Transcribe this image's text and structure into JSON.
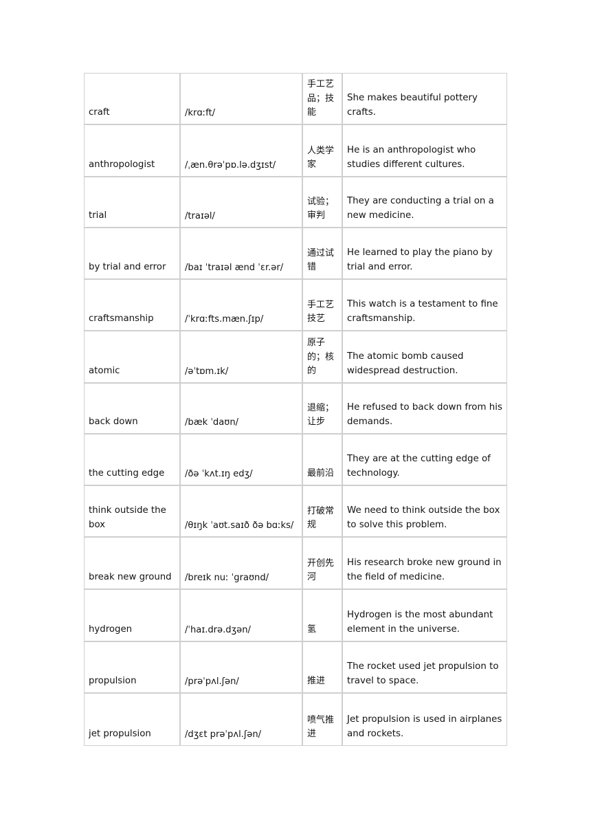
{
  "document": {
    "type": "vocabulary-table",
    "background_color": "#ffffff",
    "text_color": "#121212",
    "border_color": "#cfcfcf",
    "columns": [
      "word",
      "phonetic",
      "meaning_zh",
      "example"
    ]
  },
  "table": {
    "rows": [
      {
        "word": "craft",
        "phonetic": "/krɑːft/",
        "meaning_zh": "手工艺品；技能",
        "example": "She makes beautiful pottery crafts."
      },
      {
        "word": "anthropologist",
        "phonetic": "/ˌæn.θrəˈpɒ.lə.dʒɪst/",
        "meaning_zh": "人类学家",
        "example": "He is an anthropologist who studies different cultures."
      },
      {
        "word": "trial",
        "phonetic": "/traɪəl/",
        "meaning_zh": "试验；审判",
        "example": "They are conducting a trial on a new medicine."
      },
      {
        "word": "by trial and error",
        "phonetic": "/baɪ ˈtraɪəl ænd ˈɛr.ər/",
        "meaning_zh": "通过试错",
        "example": "He learned to play the piano by trial and error."
      },
      {
        "word": "craftsmanship",
        "phonetic": "/ˈkrɑːfts.mæn.ʃɪp/",
        "meaning_zh": "手工艺技艺",
        "example": "This watch is a testament to fine craftsmanship."
      },
      {
        "word": "atomic",
        "phonetic": "/əˈtɒm.ɪk/",
        "meaning_zh": "原子的；核的",
        "example": "The atomic bomb caused widespread destruction."
      },
      {
        "word": "back down",
        "phonetic": "/bæk ˈdaʊn/",
        "meaning_zh": "退缩；让步",
        "example": "He refused to back down from his demands."
      },
      {
        "word": "the cutting edge",
        "phonetic": "/ðə ˈkʌt.ɪŋ edʒ/",
        "meaning_zh": "最前沿",
        "example": "They are at the cutting edge of technology."
      },
      {
        "word": "think outside the box",
        "phonetic": "/θɪŋk ˈaʊt.saɪð ðə bɑːks/",
        "meaning_zh": "打破常规",
        "example": "We need to think outside the box to solve this problem."
      },
      {
        "word": "break new ground",
        "phonetic": "/breɪk nuː ˈgraʊnd/",
        "meaning_zh": "开创先河",
        "example": "His research broke new ground in the field of medicine."
      },
      {
        "word": "hydrogen",
        "phonetic": "/ˈhaɪ.drə.dʒən/",
        "meaning_zh": "氢",
        "example": "Hydrogen is the most abundant element in the universe."
      },
      {
        "word": "propulsion",
        "phonetic": "/prəˈpʌl.ʃən/",
        "meaning_zh": "推进",
        "example": "The rocket used jet propulsion to travel to space."
      },
      {
        "word": "jet propulsion",
        "phonetic": "/dʒɛt prəˈpʌl.ʃən/",
        "meaning_zh": "喷气推进",
        "example": "Jet propulsion is used in airplanes and rockets."
      }
    ]
  }
}
